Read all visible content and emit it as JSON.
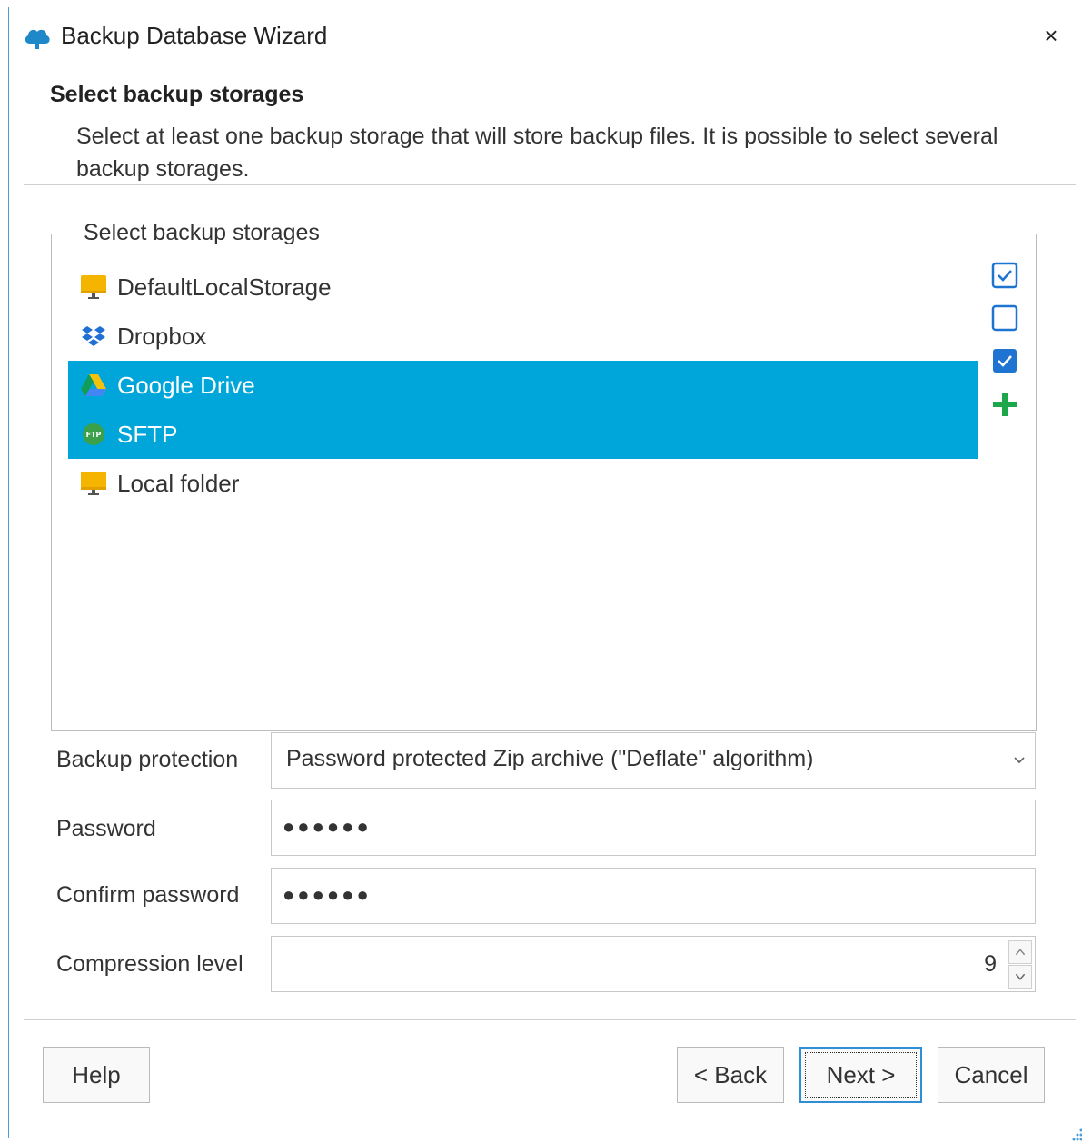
{
  "window": {
    "title": "Backup Database Wizard",
    "close_label": "×"
  },
  "header": {
    "title": "Select backup storages",
    "description": "Select at least one backup storage that will store backup files. It is possible to select several backup storages."
  },
  "storages_group": {
    "legend": "Select backup storages",
    "items": [
      {
        "label": "DefaultLocalStorage",
        "icon": "local-storage-icon",
        "selected": false
      },
      {
        "label": "Dropbox",
        "icon": "dropbox-icon",
        "selected": false
      },
      {
        "label": "Google Drive",
        "icon": "google-drive-icon",
        "selected": true
      },
      {
        "label": "SFTP",
        "icon": "sftp-icon",
        "selected": true
      },
      {
        "label": "Local folder",
        "icon": "local-folder-icon",
        "selected": false
      }
    ],
    "tools": [
      "check-all-icon",
      "uncheck-all-icon",
      "check-selected-icon",
      "add-storage-icon"
    ]
  },
  "form": {
    "protection_label": "Backup protection",
    "protection_value": "Password protected Zip archive (\"Deflate\" algorithm)",
    "password_label": "Password",
    "password_value": "●●●●●●",
    "confirm_label": "Confirm password",
    "confirm_value": "●●●●●●",
    "compression_label": "Compression level",
    "compression_value": "9"
  },
  "buttons": {
    "help": "Help",
    "back": "< Back",
    "next": "Next >",
    "cancel": "Cancel"
  },
  "colors": {
    "selection": "#00a6da",
    "accent": "#2f8fd6",
    "add_green": "#1ea64a"
  }
}
